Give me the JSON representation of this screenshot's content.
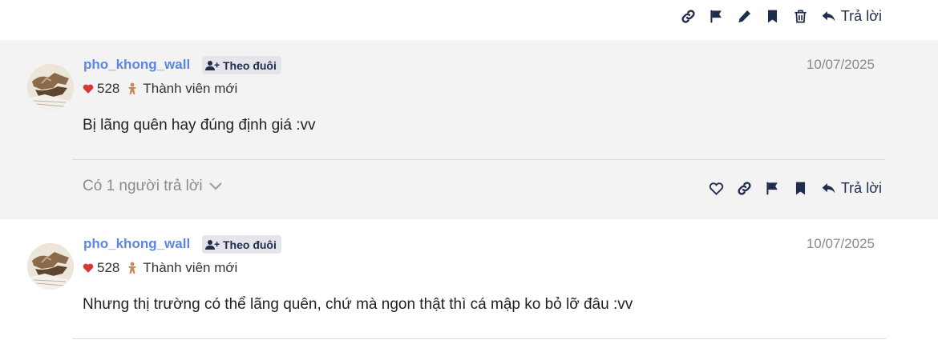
{
  "top_actions": {
    "reply_label": "Trả lời"
  },
  "posts": [
    {
      "username": "pho_khong_wall",
      "follow_label": "Theo đuôi",
      "date": "10/07/2025",
      "likes": "528",
      "rank": "Thành viên mới",
      "content": "Bị lãng quên hay đúng định giá :vv",
      "replies_label": "Có 1 người trả lời",
      "reply_label": "Trả lời"
    },
    {
      "username": "pho_khong_wall",
      "follow_label": "Theo đuôi",
      "date": "10/07/2025",
      "likes": "528",
      "rank": "Thành viên mới",
      "content": "Nhưng thị trường có thể lãng quên, chứ mà ngon thật thì cá mập ko bỏ lỡ đâu :vv"
    }
  ],
  "colors": {
    "username": "#5b86e5",
    "icon": "#1f2d4d",
    "heart": "#d23a3a",
    "rank_icon": "#c98b4b",
    "gray_bg": "#f3f3f3"
  },
  "icons": [
    "link-icon",
    "flag-icon",
    "pencil-icon",
    "bookmark-icon",
    "trash-icon",
    "reply-icon",
    "heart-outline-icon",
    "user-plus-icon",
    "heart-icon",
    "rank-icon",
    "chevron-down-icon"
  ]
}
